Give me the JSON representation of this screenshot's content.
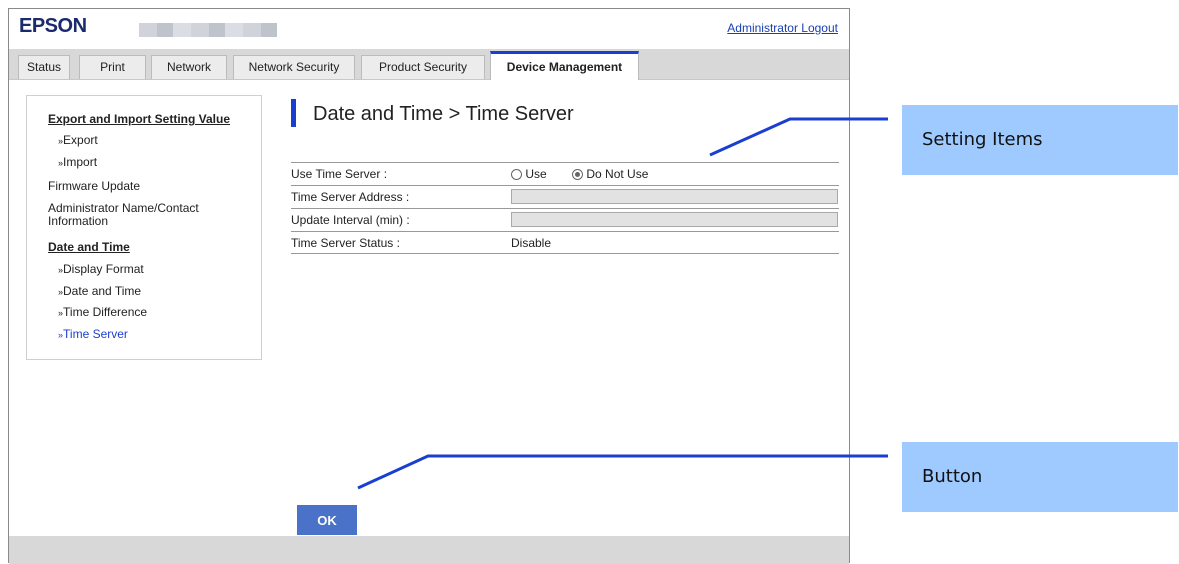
{
  "header": {
    "logo": "EPSON",
    "logout_label": "Administrator Logout"
  },
  "tabs": [
    {
      "label": "Status",
      "active": false
    },
    {
      "label": "Print",
      "active": false
    },
    {
      "label": "Network",
      "active": false
    },
    {
      "label": "Network Security",
      "active": false
    },
    {
      "label": "Product Security",
      "active": false
    },
    {
      "label": "Device Management",
      "active": true
    }
  ],
  "sidebar": {
    "items": [
      {
        "label": "Export and Import Setting Value",
        "type": "heading"
      },
      {
        "label": "Export",
        "type": "sub"
      },
      {
        "label": "Import",
        "type": "sub"
      },
      {
        "label": "Firmware Update",
        "type": "item"
      },
      {
        "label": "Administrator Name/Contact",
        "type": "item"
      },
      {
        "label": "Information",
        "type": "item"
      },
      {
        "label": "Date and Time",
        "type": "heading"
      },
      {
        "label": "Display Format",
        "type": "sub"
      },
      {
        "label": "Date and Time",
        "type": "sub"
      },
      {
        "label": "Time Difference",
        "type": "sub"
      },
      {
        "label": "Time Server",
        "type": "sub",
        "current": true
      }
    ],
    "sub_marker": "»"
  },
  "main": {
    "title": "Date and Time > Time Server",
    "rows": {
      "use_time_server": {
        "label": "Use Time Server :",
        "options": [
          "Use",
          "Do Not Use"
        ],
        "selected": "Do Not Use"
      },
      "server_address": {
        "label": "Time Server Address :",
        "value": ""
      },
      "update_interval": {
        "label": "Update Interval (min) :",
        "value": ""
      },
      "server_status": {
        "label": "Time Server Status :",
        "value": "Disable"
      }
    },
    "ok_label": "OK"
  },
  "callouts": {
    "setting_items": "Setting Items",
    "button": "Button"
  },
  "colors": {
    "accent": "#1a3fd0",
    "ok_button": "#4a72c9",
    "callout_bg": "#9ecaff",
    "logo": "#1a2a6c"
  }
}
